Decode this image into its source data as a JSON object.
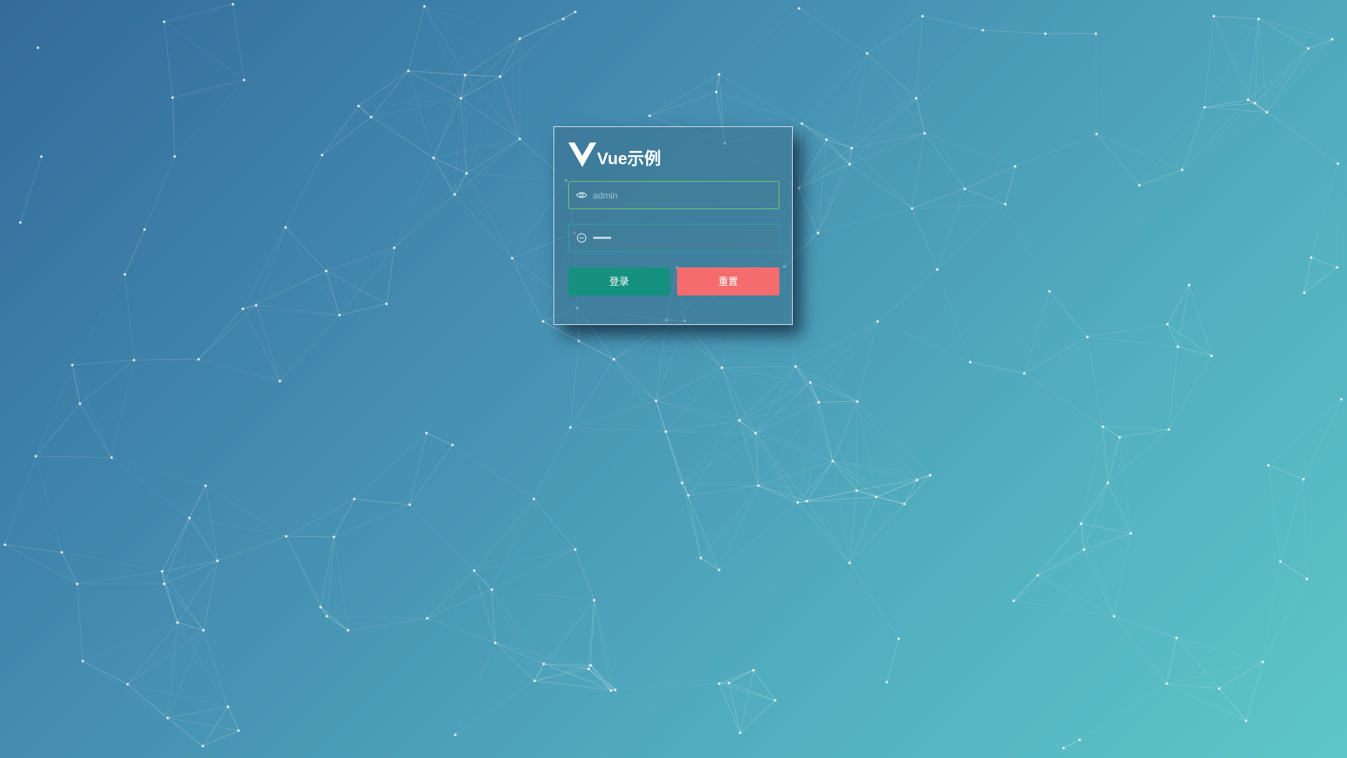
{
  "app": {
    "title": "Vue示例",
    "logo_icon": "vue-v-logo-icon"
  },
  "login_form": {
    "username": {
      "icon": "eye-icon",
      "value": "",
      "placeholder": "admin"
    },
    "password": {
      "icon": "minus-circle-icon",
      "value": "12345678",
      "placeholder": ""
    },
    "login_label": "登录",
    "reset_label": "重置"
  },
  "colors": {
    "background_start": "#336b9c",
    "background_end": "#5ec6c8",
    "login_button": "#17917f",
    "reset_button": "#f46c6e",
    "username_border": "#6fd06a",
    "password_border": "#2ea5a0"
  }
}
